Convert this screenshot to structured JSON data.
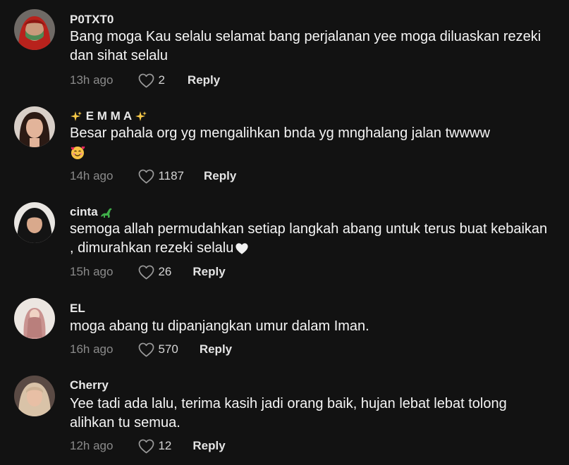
{
  "comments": [
    {
      "username": "P0TXT0",
      "text": "Bang moga Kau selalu selamat bang perjalanan yee moga diluaskan rezeki dan sihat selalu",
      "time": "13h ago",
      "likes": "2",
      "reply_label": "Reply",
      "avatar": "avatar-woman-green-mask-red-hijab"
    },
    {
      "username_prefix_icon": "sparkles-icon",
      "username": " E M M A ",
      "username_suffix_icon": "sparkles-icon",
      "text": "Besar pahala org yg mengalihkan bnda yg mnghalang jalan twwww",
      "text_emoji": "smiling-face-with-hearts-icon",
      "time": "14h ago",
      "likes": "1187",
      "reply_label": "Reply",
      "avatar": "avatar-woman-dark-hair"
    },
    {
      "username": "cinta",
      "username_suffix_icon": "sauropod-icon",
      "text": "semoga allah permudahkan setiap langkah abang untuk terus buat kebaikan , dimurahkan rezeki selalu",
      "text_emoji": "white-heart-icon",
      "time": "15h ago",
      "likes": "26",
      "reply_label": "Reply",
      "avatar": "avatar-woman-black-hijab"
    },
    {
      "username": "EL",
      "text": "moga abang tu dipanjangkan umur dalam Iman.",
      "time": "16h ago",
      "likes": "570",
      "reply_label": "Reply",
      "avatar": "avatar-illustrated-pink-hijab"
    },
    {
      "username": "Cherry",
      "text": "Yee tadi ada lalu, terima kasih jadi orang baik, hujan lebat lebat tolong alihkan tu semua.",
      "time": "12h ago",
      "likes": "12",
      "reply_label": "Reply",
      "avatar": "avatar-woman-beige-hijab"
    }
  ],
  "colors": {
    "background": "#121212",
    "username": "#e9e9e9",
    "text": "#f5f5f5",
    "meta": "#8a8a8a",
    "reply": "#e4e4e4"
  }
}
